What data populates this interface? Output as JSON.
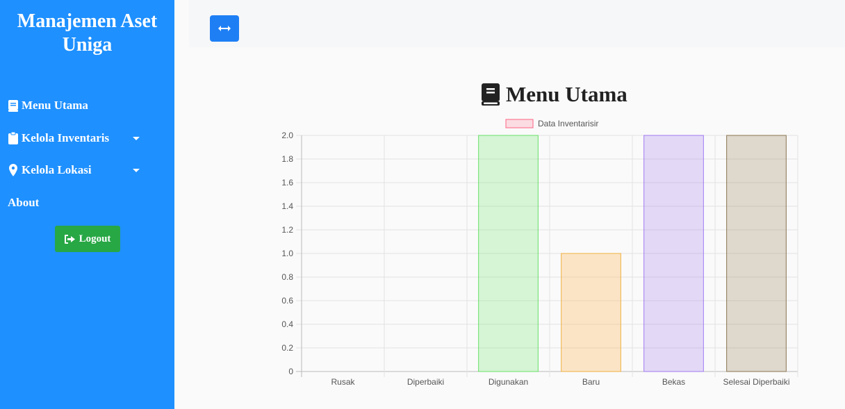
{
  "sidebar": {
    "brand": "Manajemen Aset Uniga",
    "items": [
      {
        "label": "Menu Utama"
      },
      {
        "label": "Kelola Inventaris"
      },
      {
        "label": "Kelola Lokasi"
      },
      {
        "label": "About"
      }
    ],
    "logout_label": "Logout"
  },
  "colors": {
    "sidebar": "#1e90ff",
    "logout": "#28a745",
    "toggle": "#1e7ff5"
  },
  "main": {
    "title": "Menu Utama"
  },
  "chart_data": {
    "type": "bar",
    "categories": [
      "Rusak",
      "Diperbaiki",
      "Digunakan",
      "Baru",
      "Bekas",
      "Selesai Diperbaiki"
    ],
    "series": [
      {
        "name": "Data Inventarisir",
        "values": [
          0,
          0,
          2,
          1,
          2,
          2
        ]
      }
    ],
    "bar_fill": [
      "rgba(255,99,132,0.2)",
      "rgba(54,162,235,0.2)",
      "rgba(102,230,102,0.25)",
      "rgba(255,178,80,0.3)",
      "rgba(160,120,240,0.25)",
      "rgba(150,130,90,0.28)"
    ],
    "bar_border": [
      "#ff6384",
      "#36a2eb",
      "#66e066",
      "#f0b040",
      "#a078f0",
      "#8a7550"
    ],
    "legend_fill": "rgba(255,99,132,0.2)",
    "legend_border": "#ff6384",
    "ylim": [
      0,
      2.0
    ],
    "yticks": [
      "0",
      "0.2",
      "0.4",
      "0.6",
      "0.8",
      "1.0",
      "1.2",
      "1.4",
      "1.6",
      "1.8",
      "2.0"
    ],
    "grid": true,
    "legend_position": "top"
  }
}
